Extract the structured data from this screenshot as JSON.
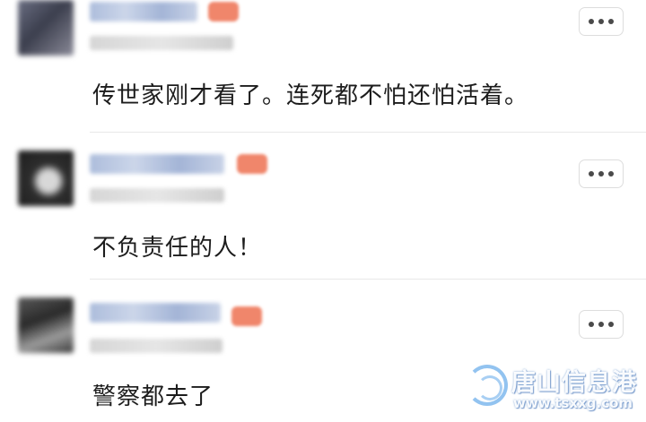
{
  "comments": [
    {
      "text": "传世家刚才看了。连死都不怕还怕活着。",
      "more_icon": "more-horizontal-icon"
    },
    {
      "text": "不负责任的人！",
      "more_icon": "more-horizontal-icon"
    },
    {
      "text": "警察都去了",
      "more_icon": "more-horizontal-icon"
    }
  ],
  "watermark": {
    "title": "唐山信息港",
    "url": "www.tsxxg.com",
    "logo_icon": "wave-logo-icon"
  }
}
